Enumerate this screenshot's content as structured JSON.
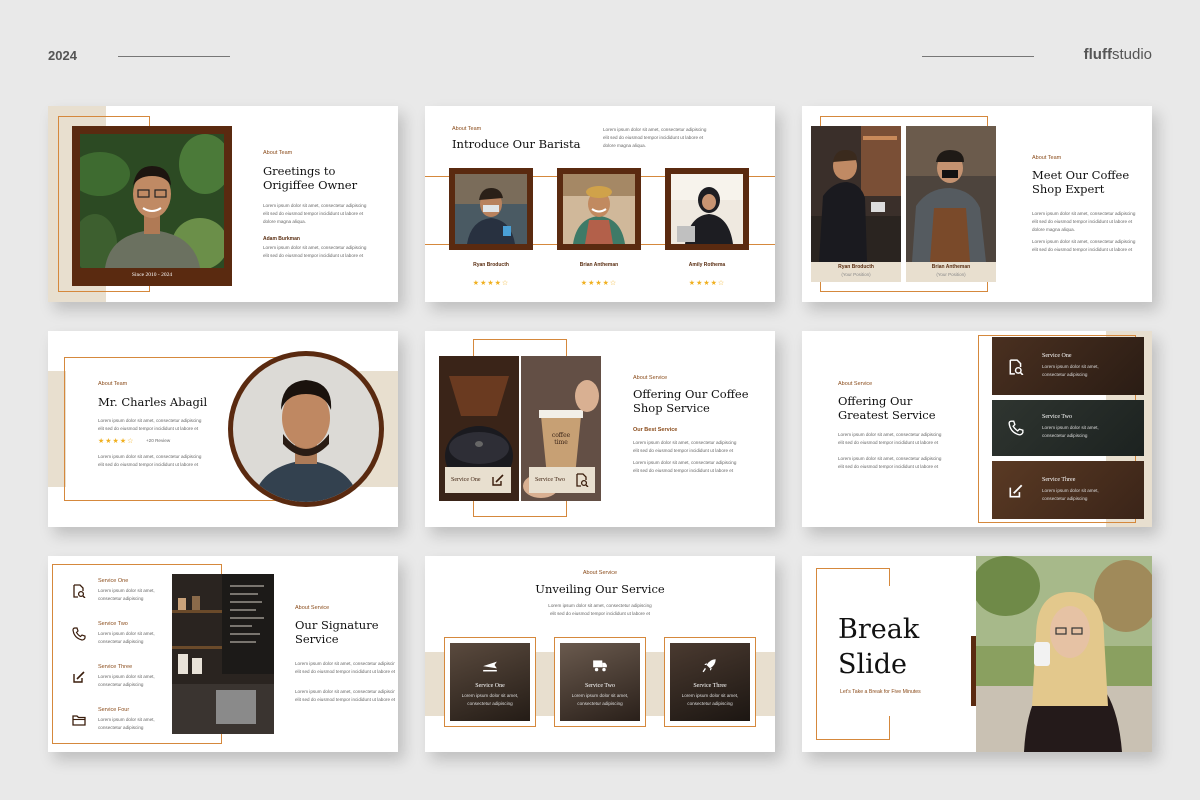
{
  "header": {
    "year": "2024",
    "brand_a": "fluff",
    "brand_b": "studio"
  },
  "colors": {
    "accent": "#d5883c",
    "brown": "#5a2a10",
    "tan": "#e8dfcf",
    "star": "#f0b020"
  },
  "lorem": {
    "l1": "Lorem ipsum dolor sit amet, consectetur adipiscing",
    "l2": "elit sed do eiusmod tempor incididunt ut labore et",
    "l3": "dolore magna aliqua.",
    "s1": "Lorem ipsum dolor sit amet,",
    "s2": "consectetur adipiscing"
  },
  "s1": {
    "label": "About Team",
    "title1": "Greetings to",
    "title2": "Origiffee Owner",
    "caption": "Since 2010 - 2024",
    "name": "Adam Burkman"
  },
  "s2": {
    "label": "About Team",
    "title": "Introduce Our Barista",
    "people": [
      {
        "name": "Ryan Broducth",
        "stars": "★★★★☆"
      },
      {
        "name": "Brian Antheman",
        "stars": "★★★★☆"
      },
      {
        "name": "Amily Rothema",
        "stars": "★★★★☆"
      }
    ]
  },
  "s3": {
    "label": "About Team",
    "title1": "Meet Our Coffee",
    "title2": "Shop Expert",
    "people": [
      {
        "name": "Ryan Broducth",
        "pos": "(Your Position)"
      },
      {
        "name": "Brian Antheman",
        "pos": "(Your Position)"
      }
    ]
  },
  "s4": {
    "label": "About Team",
    "title": "Mr. Charles Abagil",
    "stars": "★★★★☆",
    "review": "+20 Review"
  },
  "s5": {
    "label": "About Service",
    "title1": "Offering Our Coffee",
    "title2": "Shop Service",
    "sub": "Our Best Service",
    "btn1": "Service One",
    "btn2": "Service Two",
    "cup": "coffee time"
  },
  "s6": {
    "label": "About Service",
    "title1": "Offering Our",
    "title2": "Greatest  Service",
    "items": [
      "Service One",
      "Service Two",
      "Service Three"
    ]
  },
  "s7": {
    "label": "About Service",
    "title1": "Our Signature",
    "title2": "Service",
    "items": [
      "Service One",
      "Service Two",
      "Service Three",
      "Service Four"
    ]
  },
  "s8": {
    "label": "About Service",
    "title": "Unveiling Our Service",
    "items": [
      "Service One",
      "Service Two",
      "Service Three"
    ]
  },
  "s9": {
    "title1": "Break",
    "title2": "Slide",
    "sub": "Let's Take a Break for Five Minutes"
  }
}
